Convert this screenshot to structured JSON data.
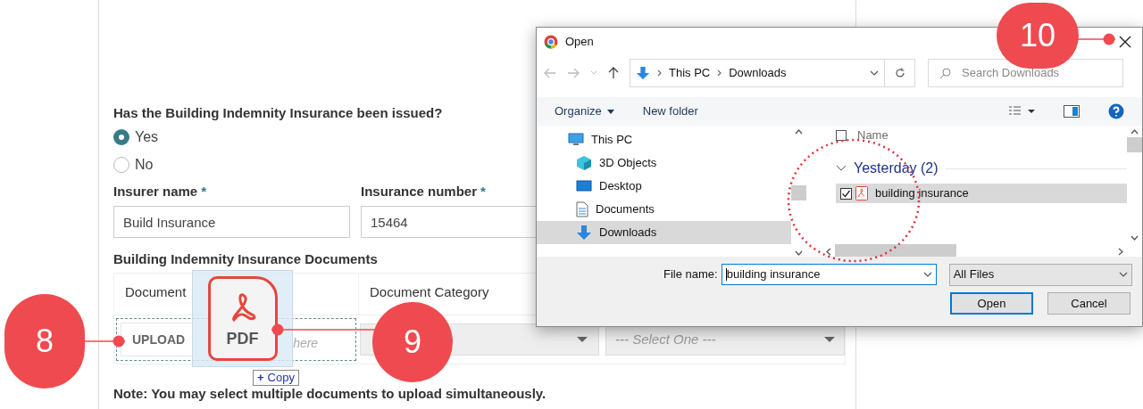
{
  "form": {
    "question": "Has the Building Indemnity Insurance been issued?",
    "options": [
      {
        "label": "Yes",
        "selected": true
      },
      {
        "label": "No",
        "selected": false
      }
    ],
    "fields": [
      {
        "label": "Insurer name",
        "required_mark": "*",
        "value": "Build Insurance"
      },
      {
        "label": "Insurance number",
        "required_mark": "*",
        "value": "15464"
      }
    ],
    "documents": {
      "title": "Building Indemnity Insurance Documents",
      "columns": [
        "Document",
        "Document Category"
      ],
      "upload_button": "UPLOAD",
      "drop_hint": "here",
      "type_select": {
        "placeholder": "--- Select One ---"
      }
    },
    "note": "Note: You may select multiple documents to upload simultaneously."
  },
  "drag": {
    "file_label": "PDF",
    "badge_icon": "+",
    "badge": "Copy"
  },
  "dialog": {
    "title": "Open",
    "breadcrumb": [
      "This PC",
      "Downloads"
    ],
    "search_placeholder": "Search Downloads",
    "toolbar": [
      "Organize",
      "New folder"
    ],
    "tree": [
      {
        "label": "This PC",
        "kind": "pc",
        "selected": false
      },
      {
        "label": "3D Objects",
        "kind": "cube",
        "selected": false
      },
      {
        "label": "Desktop",
        "kind": "desktop",
        "selected": false
      },
      {
        "label": "Documents",
        "kind": "document",
        "selected": false
      },
      {
        "label": "Downloads",
        "kind": "download",
        "selected": true
      }
    ],
    "column": "Name",
    "column_checkbox": {
      "checked": false
    },
    "group": {
      "label": "Yesterday (2)",
      "expanded": true
    },
    "files": [
      {
        "name": "building insurance",
        "checked": true,
        "selected": true
      }
    ],
    "file_name_label": "File name:",
    "file_name": "building insurance",
    "filter": "All Files",
    "buttons": [
      {
        "label": "Open",
        "default": true
      },
      {
        "label": "Cancel",
        "default": false
      }
    ]
  },
  "callouts": [
    {
      "number": "8"
    },
    {
      "number": "9"
    },
    {
      "number": "10"
    }
  ]
}
